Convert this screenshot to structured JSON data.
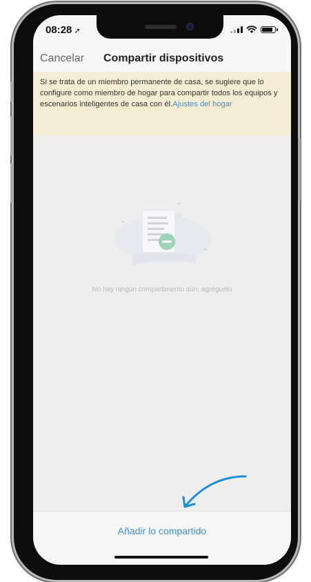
{
  "status_bar": {
    "time": "08:28",
    "location_icon": "location-arrow-icon",
    "signal_icon": "signal-bars-icon",
    "wifi_icon": "wifi-icon",
    "battery_icon": "battery-icon",
    "battery_level": 0.85
  },
  "nav": {
    "cancel_label": "Cancelar",
    "title": "Compartir dispositivos"
  },
  "notice": {
    "text": "Si se trata de un miembro permanente de casa, se sugiere que lo configure como miembro de hogar para compartir todos los equipos y escenarios inteligentes de casa con él.",
    "link_label": "Ajustes del hogar",
    "background": "#f4ecd3",
    "link_color": "#3d8fd1"
  },
  "empty_state": {
    "icon": "empty-document-icon",
    "message": "No hay ningún compartimento aún, agréguelo"
  },
  "bottom": {
    "add_label": "Añadir lo compartido",
    "accent": "#3d8fd1"
  },
  "annotation": {
    "icon": "curved-arrow-icon",
    "color": "#1e8fd6"
  }
}
